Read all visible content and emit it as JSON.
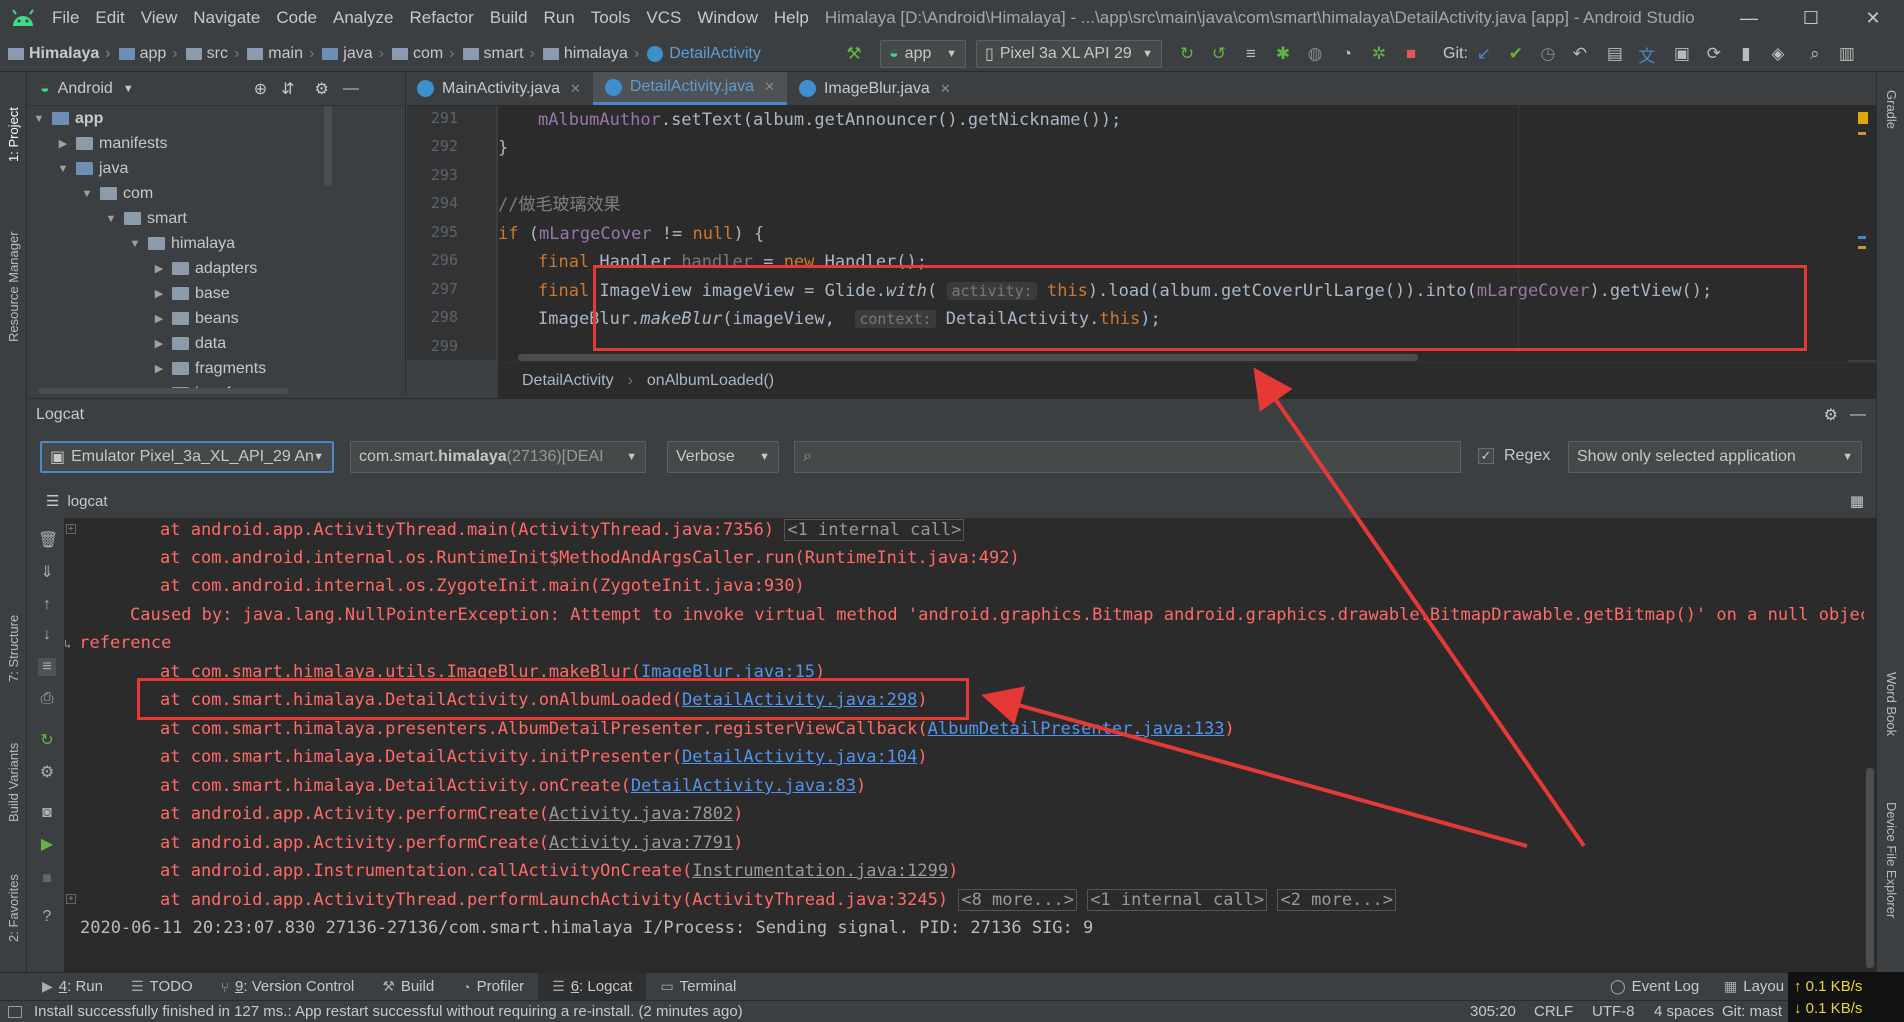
{
  "window": {
    "menu": [
      "File",
      "Edit",
      "View",
      "Navigate",
      "Code",
      "Analyze",
      "Refactor",
      "Build",
      "Run",
      "Tools",
      "VCS",
      "Window",
      "Help"
    ],
    "title": "Himalaya [D:\\Android\\Himalaya] - ...\\app\\src\\main\\java\\com\\smart\\himalaya\\DetailActivity.java [app] - Android Studio",
    "controls": [
      "—",
      "☐",
      "✕"
    ]
  },
  "navbar": {
    "breadcrumbs": [
      "Himalaya",
      "app",
      "src",
      "main",
      "java",
      "com",
      "smart",
      "himalaya",
      "DetailActivity"
    ],
    "run_config": "app",
    "device": "Pixel 3a XL API 29",
    "git_label": "Git:"
  },
  "left_strip": {
    "project": "1: Project",
    "resource_manager": "Resource Manager",
    "structure": "7: Structure",
    "build_variants": "Build Variants",
    "favorites": "2: Favorites"
  },
  "right_strip": {
    "gradle": "Gradle",
    "word_book": "Word Book",
    "device_file_explorer": "Device File Explorer"
  },
  "project_panel": {
    "view_mode": "Android",
    "tree": [
      {
        "label": "app",
        "depth": 0,
        "bold": true,
        "arrow": "▼"
      },
      {
        "label": "manifests",
        "depth": 1,
        "arrow": "▶"
      },
      {
        "label": "java",
        "depth": 1,
        "arrow": "▼"
      },
      {
        "label": "com",
        "depth": 2,
        "arrow": "▼"
      },
      {
        "label": "smart",
        "depth": 3,
        "arrow": "▼"
      },
      {
        "label": "himalaya",
        "depth": 4,
        "arrow": "▼"
      },
      {
        "label": "adapters",
        "depth": 5,
        "arrow": "▶"
      },
      {
        "label": "base",
        "depth": 5,
        "arrow": "▶"
      },
      {
        "label": "beans",
        "depth": 5,
        "arrow": "▶"
      },
      {
        "label": "data",
        "depth": 5,
        "arrow": "▶"
      },
      {
        "label": "fragments",
        "depth": 5,
        "arrow": "▶"
      },
      {
        "label": "interfaces",
        "depth": 5,
        "arrow": "▶"
      }
    ]
  },
  "editor": {
    "tabs": [
      {
        "label": "MainActivity.java",
        "active": false
      },
      {
        "label": "DetailActivity.java",
        "active": true
      },
      {
        "label": "ImageBlur.java",
        "active": false
      }
    ],
    "line_numbers": [
      "291",
      "292",
      "293",
      "294",
      "295",
      "296",
      "297",
      "298",
      "299"
    ],
    "code": {
      "l291_field": "mAlbumAuthor",
      "l291_rest": ".setText(album.getAnnouncer().getNickname());",
      "l292": "}",
      "l294_comment": "//做毛玻璃效果",
      "l295_if": "if",
      "l295_open": " (",
      "l295_field": "mLargeCover",
      "l295_op": " != ",
      "l295_null": "null",
      "l295_close": ") {",
      "l296_final": "final ",
      "l296_type": "Handler ",
      "l296_var": "handler",
      "l296_eq": " = ",
      "l296_new": "new ",
      "l296_rest": "Handler();",
      "l297_final": "final ",
      "l297_a": "ImageView imageView = Glide.",
      "l297_with": "with",
      "l297_paren": "( ",
      "l297_hint": "activity:",
      "l297_this": " this",
      "l297_b": ").load(album.getCoverUrlLarge()).into(",
      "l297_field": "mLargeCover",
      "l297_c": ").getView();",
      "l298_a": "ImageBlur.",
      "l298_method": "makeBlur",
      "l298_b": "(imageView,  ",
      "l298_hint": "context:",
      "l298_c": " DetailActivity.",
      "l298_this": "this",
      "l298_d": ");"
    },
    "breadcrumb": [
      "DetailActivity",
      "onAlbumLoaded()"
    ]
  },
  "logcat": {
    "title": "Logcat",
    "device_combo": "Emulator Pixel_3a_XL_API_29 Anc",
    "process_prefix": "com.smart.",
    "process_bold": "himalaya",
    "process_pid": " (27136) ",
    "process_state": "[DEAI",
    "level": "Verbose",
    "search_placeholder": "",
    "regex_label": "Regex",
    "filter": "Show only selected application",
    "subtab": "logcat",
    "lines": {
      "l1_a": "at android.app.ActivityThread.main(ActivityThread.java:7356)",
      "l1_b": "<1 internal call>",
      "l2": "at com.android.internal.os.RuntimeInit$MethodAndArgsCaller.run(RuntimeInit.java:492)",
      "l3": "at com.android.internal.os.ZygoteInit.main(ZygoteInit.java:930)",
      "l4": "Caused by: java.lang.NullPointerException: Attempt to invoke virtual method 'android.graphics.Bitmap android.graphics.drawable.BitmapDrawable.getBitmap()' on a null object",
      "l5": "reference",
      "l6_a": "at com.smart.himalaya.utils.ImageBlur.makeBlur(",
      "l6_link": "ImageBlur.java:15",
      "l6_b": ")",
      "l7_a": "at com.smart.himalaya.DetailActivity.onAlbumLoaded(",
      "l7_link": "DetailActivity.java:298",
      "l7_b": ")",
      "l8_a": "at com.smart.himalaya.presenters.AlbumDetailPresenter.registerViewCallback(",
      "l8_link": "AlbumDetailPresenter.java:133",
      "l8_b": ")",
      "l9_a": "at com.smart.himalaya.DetailActivity.initPresenter(",
      "l9_link": "DetailActivity.java:104",
      "l9_b": ")",
      "l10_a": "at com.smart.himalaya.DetailActivity.onCreate(",
      "l10_link": "DetailActivity.java:83",
      "l10_b": ")",
      "l11_a": "at android.app.Activity.performCreate(",
      "l11_link": "Activity.java:7802",
      "l11_b": ")",
      "l12_a": "at android.app.Activity.performCreate(",
      "l12_link": "Activity.java:7791",
      "l12_b": ")",
      "l13_a": "at android.app.Instrumentation.callActivityOnCreate(",
      "l13_link": "Instrumentation.java:1299",
      "l13_b": ")",
      "l14_a": "at android.app.ActivityThread.performLaunchActivity(ActivityThread.java:3245)",
      "l14_b": "<8 more...>",
      "l14_c": "<1 internal call>",
      "l14_d": "<2 more...>",
      "l15": "2020-06-11 20:23:07.830 27136-27136/com.smart.himalaya I/Process: Sending signal. PID: 27136 SIG: 9"
    }
  },
  "bottom_tabs": [
    {
      "num": "4",
      "label": ": Run"
    },
    {
      "num": "",
      "label": "TODO"
    },
    {
      "num": "9",
      "label": ": Version Control"
    },
    {
      "num": "",
      "label": "Build"
    },
    {
      "num": "",
      "label": "Profiler"
    },
    {
      "num": "6",
      "label": ": Logcat"
    },
    {
      "num": "",
      "label": "Terminal"
    }
  ],
  "bottom_right_tabs": [
    "Event Log",
    "Layou"
  ],
  "status": {
    "message": "Install successfully finished in 127 ms.: App restart successful without requiring a re-install. (2 minutes ago)",
    "position": "305:20",
    "line_sep": "CRLF",
    "encoding": "UTF-8",
    "indent": "4 spaces",
    "git": "Git: mast",
    "net_up": "↑ 0.1 KB/s",
    "net_down": "↓ 0.1 KB/s"
  },
  "colors": {
    "annotation_red": "#e53935",
    "error_text": "#ff6b68",
    "link_blue": "#5394ec",
    "keyword_orange": "#cc7832",
    "field_purple": "#9876aa"
  }
}
